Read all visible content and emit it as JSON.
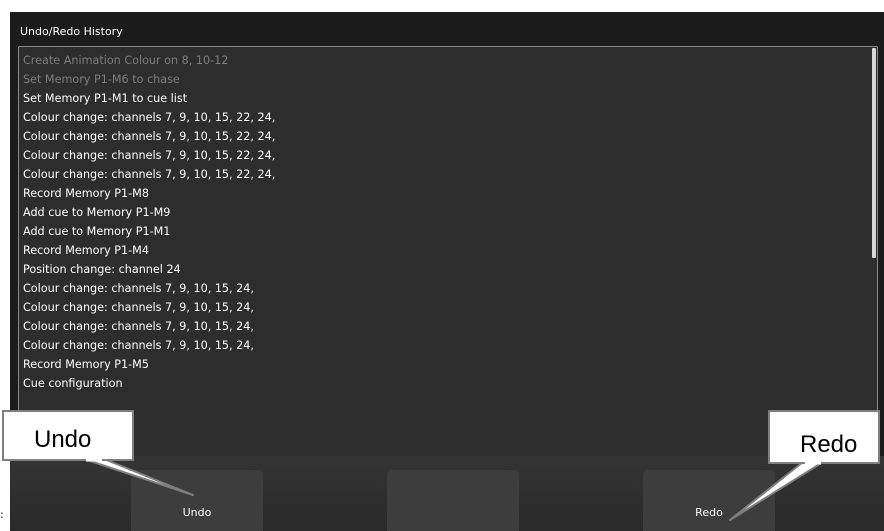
{
  "window": {
    "title": "Undo/Redo History"
  },
  "history": [
    {
      "text": "Create Animation Colour on 8, 10-12",
      "dim": true
    },
    {
      "text": "Set Memory P1-M6 to chase",
      "dim": true
    },
    {
      "text": "Set Memory P1-M1 to cue list",
      "dim": false
    },
    {
      "text": "Colour change: channels 7, 9, 10, 15, 22, 24,",
      "dim": false
    },
    {
      "text": "Colour change: channels 7, 9, 10, 15, 22, 24,",
      "dim": false
    },
    {
      "text": "Colour change: channels 7, 9, 10, 15, 22, 24,",
      "dim": false
    },
    {
      "text": "Colour change: channels 7, 9, 10, 15, 22, 24,",
      "dim": false
    },
    {
      "text": "Record Memory P1-M8",
      "dim": false
    },
    {
      "text": "Add cue to Memory P1-M9",
      "dim": false
    },
    {
      "text": "Add cue to Memory P1-M1",
      "dim": false
    },
    {
      "text": "Record Memory P1-M4",
      "dim": false
    },
    {
      "text": "Position change: channel 24",
      "dim": false
    },
    {
      "text": "Colour change: channels 7, 9, 10, 15, 24,",
      "dim": false
    },
    {
      "text": "Colour change: channels 7, 9, 10, 15, 24,",
      "dim": false
    },
    {
      "text": "Colour change: channels 7, 9, 10, 15, 24,",
      "dim": false
    },
    {
      "text": "Colour change: channels 7, 9, 10, 15, 24,",
      "dim": false
    },
    {
      "text": "Record Memory P1-M5",
      "dim": false
    },
    {
      "text": "Cue configuration",
      "dim": false
    }
  ],
  "buttons": {
    "undo_label": "Undo",
    "middle_label": "",
    "redo_label": "Redo"
  },
  "callouts": {
    "undo": "Undo",
    "redo": "Redo"
  },
  "bullet": ":",
  "colors": {
    "panel_bg": "#1c1c1c",
    "list_bg": "#2d2d2d",
    "dim_text": "#7d7d7d"
  }
}
